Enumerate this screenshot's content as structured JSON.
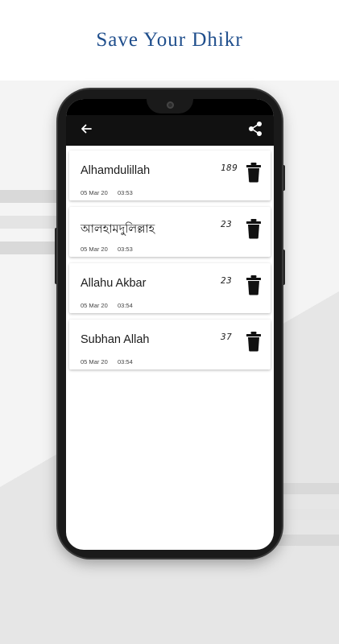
{
  "headline": "Save Your Dhikr",
  "appbar": {
    "back_icon": "arrow-left-icon",
    "share_icon": "share-icon"
  },
  "dhikr_list": [
    {
      "title": "Alhamdulillah",
      "count": "189",
      "date": "05 Mar 20",
      "time": "03:53"
    },
    {
      "title": "আলহামদুলিল্লাহ",
      "count": "23",
      "date": "05 Mar 20",
      "time": "03:53"
    },
    {
      "title": "Allahu Akbar",
      "count": "23",
      "date": "05 Mar 20",
      "time": "03:54"
    },
    {
      "title": "Subhan Allah",
      "count": "37",
      "date": "05 Mar 20",
      "time": "03:54"
    }
  ],
  "colors": {
    "headline": "#1f4e8c",
    "appbar": "#111111",
    "card": "#ffffff"
  }
}
